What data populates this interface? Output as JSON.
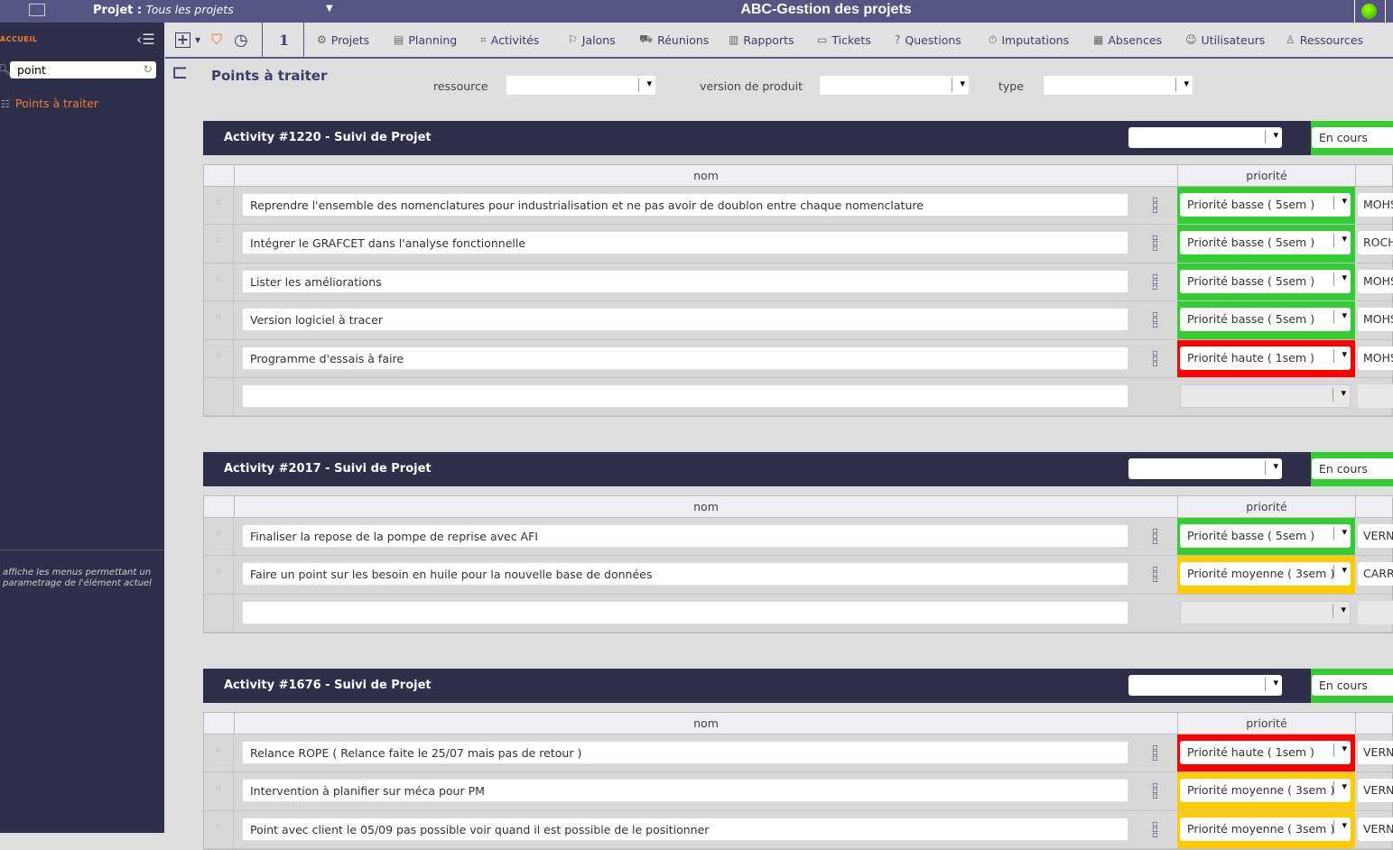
{
  "topbar": {
    "project_label": "Projet :",
    "project_value": "Tous les projets",
    "app_title": "ABC-Gestion des projets"
  },
  "sidebar": {
    "section": "ACCUEIL",
    "search_value": "point",
    "item": "Points à traiter",
    "help": "affiche les menus permettant un parametrage de l'élément actuel"
  },
  "toolbar": {
    "count": "1",
    "menu": [
      {
        "label": "Projets",
        "icon": "⚙"
      },
      {
        "label": "Planning",
        "icon": "▤"
      },
      {
        "label": "Activités",
        "icon": "⌗"
      },
      {
        "label": "Jalons",
        "icon": "⚐"
      },
      {
        "label": "Réunions",
        "icon": "⛟"
      },
      {
        "label": "Rapports",
        "icon": "▥"
      },
      {
        "label": "Tickets",
        "icon": "▭"
      },
      {
        "label": "Questions",
        "icon": "?"
      },
      {
        "label": "Imputations",
        "icon": "⏱"
      },
      {
        "label": "Absences",
        "icon": "▦"
      },
      {
        "label": "Utilisateurs",
        "icon": "☺"
      },
      {
        "label": "Ressources",
        "icon": "♙"
      }
    ]
  },
  "page": {
    "title": "Points à traiter",
    "filters": {
      "ressource": "ressource",
      "version": "version de produit",
      "type": "type"
    }
  },
  "columns": {
    "nom": "nom",
    "priorite": "priorité"
  },
  "colors": {
    "basse": "#33cc33",
    "haute": "#ff0000",
    "moyenne": "#ffcc00"
  },
  "sections": [
    {
      "title": "Activity #1220 - Suivi de Projet",
      "status": "En cours",
      "rows": [
        {
          "nom": "Reprendre l'ensemble des nomenclatures pour industrialisation et ne pas avoir de doublon entre chaque nomenclature",
          "priorite": "Priorité basse  ( 5sem )",
          "level": "basse",
          "res": "MOHS"
        },
        {
          "nom": "Intégrer le GRAFCET dans l'analyse fonctionnelle",
          "priorite": "Priorité basse  ( 5sem )",
          "level": "basse",
          "res": "ROCH"
        },
        {
          "nom": "Lister les améliorations",
          "priorite": "Priorité basse  ( 5sem )",
          "level": "basse",
          "res": "MOHS"
        },
        {
          "nom": "Version logiciel à tracer",
          "priorite": "Priorité basse  ( 5sem )",
          "level": "basse",
          "res": "MOHS"
        },
        {
          "nom": "Programme d'essais à faire",
          "priorite": "Priorité haute ( 1sem )",
          "level": "haute",
          "res": "MOHS"
        }
      ]
    },
    {
      "title": "Activity #2017 - Suivi de Projet",
      "status": "En cours",
      "rows": [
        {
          "nom": "Finaliser la repose de la pompe de reprise avec AFI",
          "priorite": "Priorité basse  ( 5sem )",
          "level": "basse",
          "res": "VERN"
        },
        {
          "nom": "Faire un point sur les besoin en huile pour la nouvelle base de données",
          "priorite": "Priorité moyenne ( 3sem )",
          "level": "moyenne",
          "res": "CARR"
        }
      ]
    },
    {
      "title": "Activity #1676 - Suivi de Projet",
      "status": "En cours",
      "rows": [
        {
          "nom": "Relance ROPE ( Relance faite le 25/07 mais pas de retour )",
          "priorite": "Priorité haute ( 1sem )",
          "level": "haute",
          "res": "VERN"
        },
        {
          "nom": "Intervention à planifier sur méca pour PM",
          "priorite": "Priorité moyenne ( 3sem )",
          "level": "moyenne",
          "res": "VERN"
        },
        {
          "nom": "Point avec client le 05/09 pas possible voir quand il est possible de le positionner",
          "priorite": "Priorité moyenne ( 3sem )",
          "level": "moyenne",
          "res": "VERN"
        }
      ]
    }
  ]
}
